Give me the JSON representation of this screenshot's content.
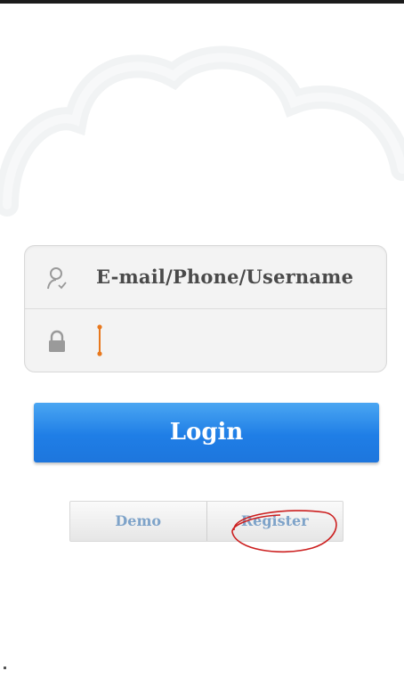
{
  "login_form": {
    "username_value": "E-mail/Phone/Username",
    "password_value": ""
  },
  "login_button": {
    "label": "Login",
    "color": "#1f7ee6"
  },
  "secondary_buttons": {
    "demo_label": "Demo",
    "register_label": "Register",
    "label_color": "#7ea3c9"
  },
  "annotation": {
    "color": "#cc1f1f",
    "shape": "ellipse around Register"
  },
  "icons": {
    "username": "user-icon",
    "password": "lock-icon",
    "background": "cloud-icon"
  }
}
